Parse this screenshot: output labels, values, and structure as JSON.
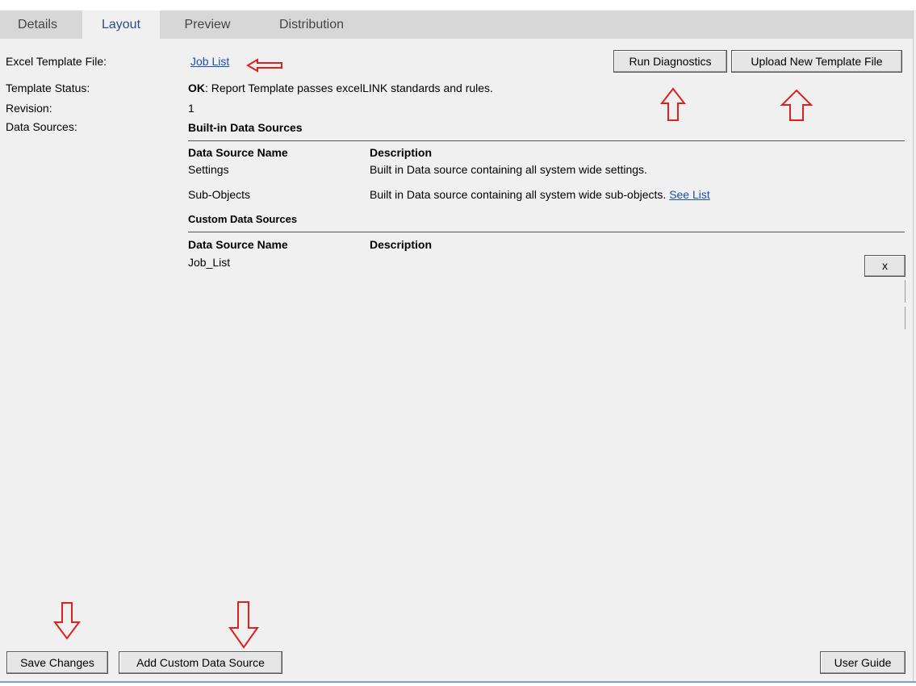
{
  "tabs": [
    {
      "label": "Details",
      "active": false
    },
    {
      "label": "Layout",
      "active": true
    },
    {
      "label": "Preview",
      "active": false
    },
    {
      "label": "Distribution",
      "active": false
    }
  ],
  "fields": {
    "template_file_label": "Excel Template File:",
    "template_file_link": "Job List",
    "status_label": "Template Status:",
    "status_ok": "OK",
    "status_message": ": Report Template passes excelLINK standards and rules.",
    "revision_label": "Revision:",
    "revision_value": "1",
    "data_sources_label": "Data Sources:"
  },
  "builtin": {
    "heading": "Built-in Data Sources",
    "col_name": "Data Source Name",
    "col_desc": "Description",
    "rows": [
      {
        "name": "Settings",
        "desc": "Built in Data source containing all system wide settings.",
        "link": ""
      },
      {
        "name": "Sub-Objects",
        "desc": "Built in Data source containing all system wide sub-objects.",
        "link": "See List"
      }
    ]
  },
  "custom": {
    "heading": "Custom Data Sources",
    "col_name": "Data Source Name",
    "col_desc": "Description",
    "rows": [
      {
        "name": "Job_List",
        "remove_label": "x"
      }
    ]
  },
  "buttons": {
    "run_diagnostics": "Run Diagnostics",
    "upload_template": "Upload New Template File",
    "save_changes": "Save Changes",
    "add_custom_source": "Add Custom Data Source",
    "user_guide": "User Guide"
  },
  "colors": {
    "annotation_arrow": "#e0201c",
    "link": "#1a4fb0",
    "active_tab_text": "#2b4d8a"
  },
  "icons": {
    "arrow_left": "arrow-left-icon",
    "arrow_up": "arrow-up-icon",
    "arrow_down": "arrow-down-icon"
  }
}
